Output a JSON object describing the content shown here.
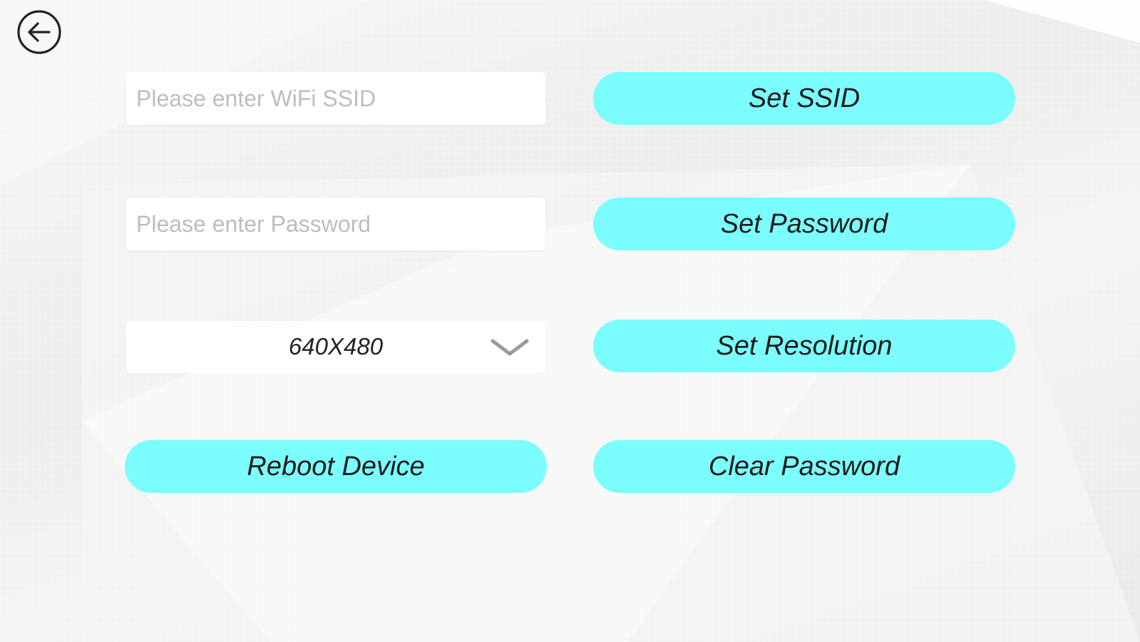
{
  "form": {
    "ssid_placeholder": "Please enter WiFi SSID",
    "ssid_value": "",
    "password_placeholder": "Please enter Password",
    "password_value": "",
    "resolution_selected": "640X480"
  },
  "buttons": {
    "set_ssid": "Set SSID",
    "set_password": "Set Password",
    "set_resolution": "Set Resolution",
    "reboot_device": "Reboot Device",
    "clear_password": "Clear Password"
  },
  "colors": {
    "button_fill": "#7bfdfd",
    "background": "#ececec",
    "field_fill": "#ffffff"
  },
  "icons": {
    "back": "arrow-left-circle-icon",
    "dropdown": "chevron-down-icon"
  }
}
